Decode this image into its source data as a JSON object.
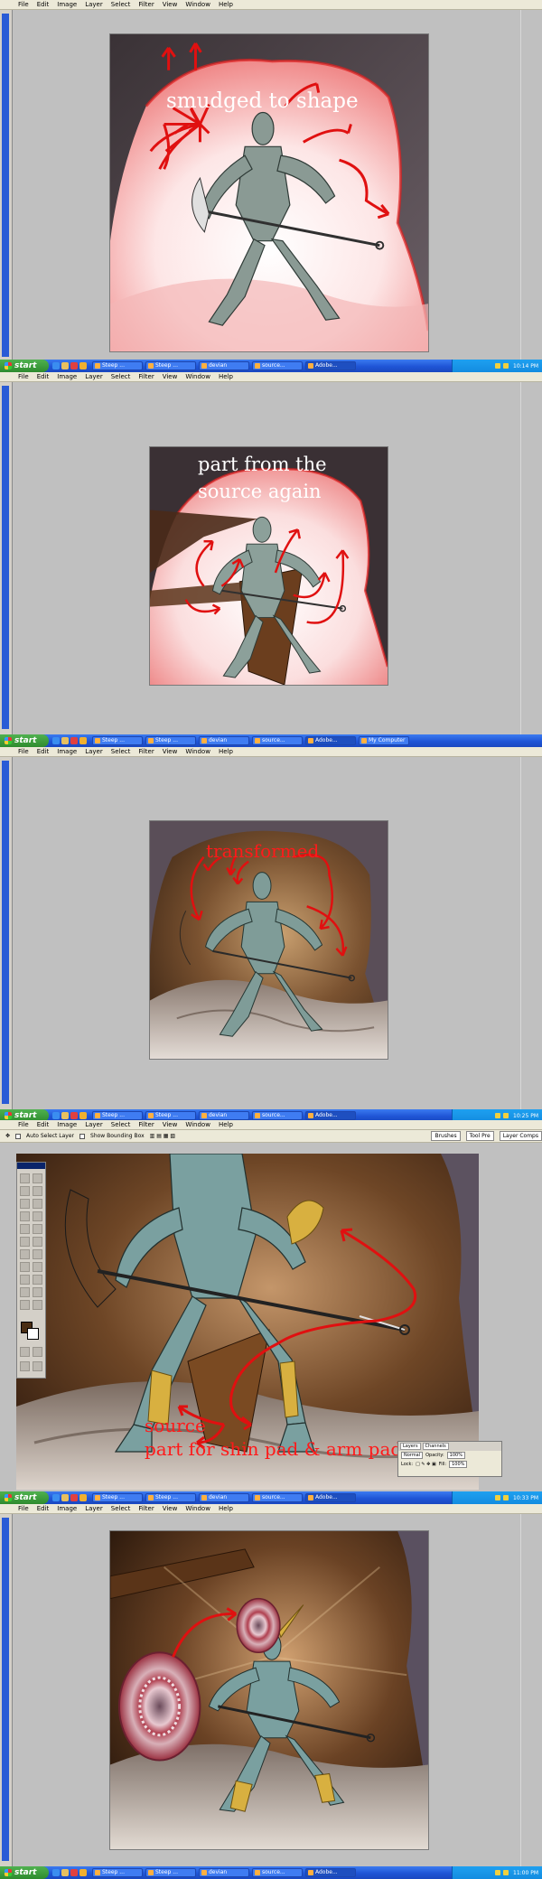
{
  "menu": [
    "File",
    "Edit",
    "Image",
    "Layer",
    "Select",
    "Filter",
    "View",
    "Window",
    "Help"
  ],
  "options_bar": {
    "auto_select": "Auto Select Layer",
    "bounding_box": "Show Bounding Box",
    "palette_tabs": [
      "Brushes",
      "Tool Pre",
      "Layer Comps"
    ]
  },
  "annotations": {
    "panel1": "smudged to shape",
    "panel2_line1": "part from the",
    "panel2_line2": "source again",
    "panel3": "transformed",
    "panel4_line1": "source",
    "panel4_line2": "part for shin pad & arm pad"
  },
  "layers_palette": {
    "tabs": [
      "Layers",
      "Channels"
    ],
    "blend_mode": "Normal",
    "opacity_label": "Opacity:",
    "opacity_value": "100%",
    "lock_label": "Lock:",
    "fill_label": "Fill:",
    "fill_value": "100%"
  },
  "taskbar": {
    "start_label": "start",
    "buttons": [
      "Steep ...",
      "Steep ...",
      "devian",
      "source...",
      "Adobe...",
      "My Computer"
    ],
    "clocks": [
      "10:14 PM",
      "10:25 PM",
      "10:33 PM",
      "11:00 PM"
    ]
  },
  "colors": {
    "annotation_red": "#ff1a1a",
    "taskbar_blue": "#245edb",
    "start_green": "#3c9b3c",
    "workspace_gray": "#c0c0c0"
  }
}
